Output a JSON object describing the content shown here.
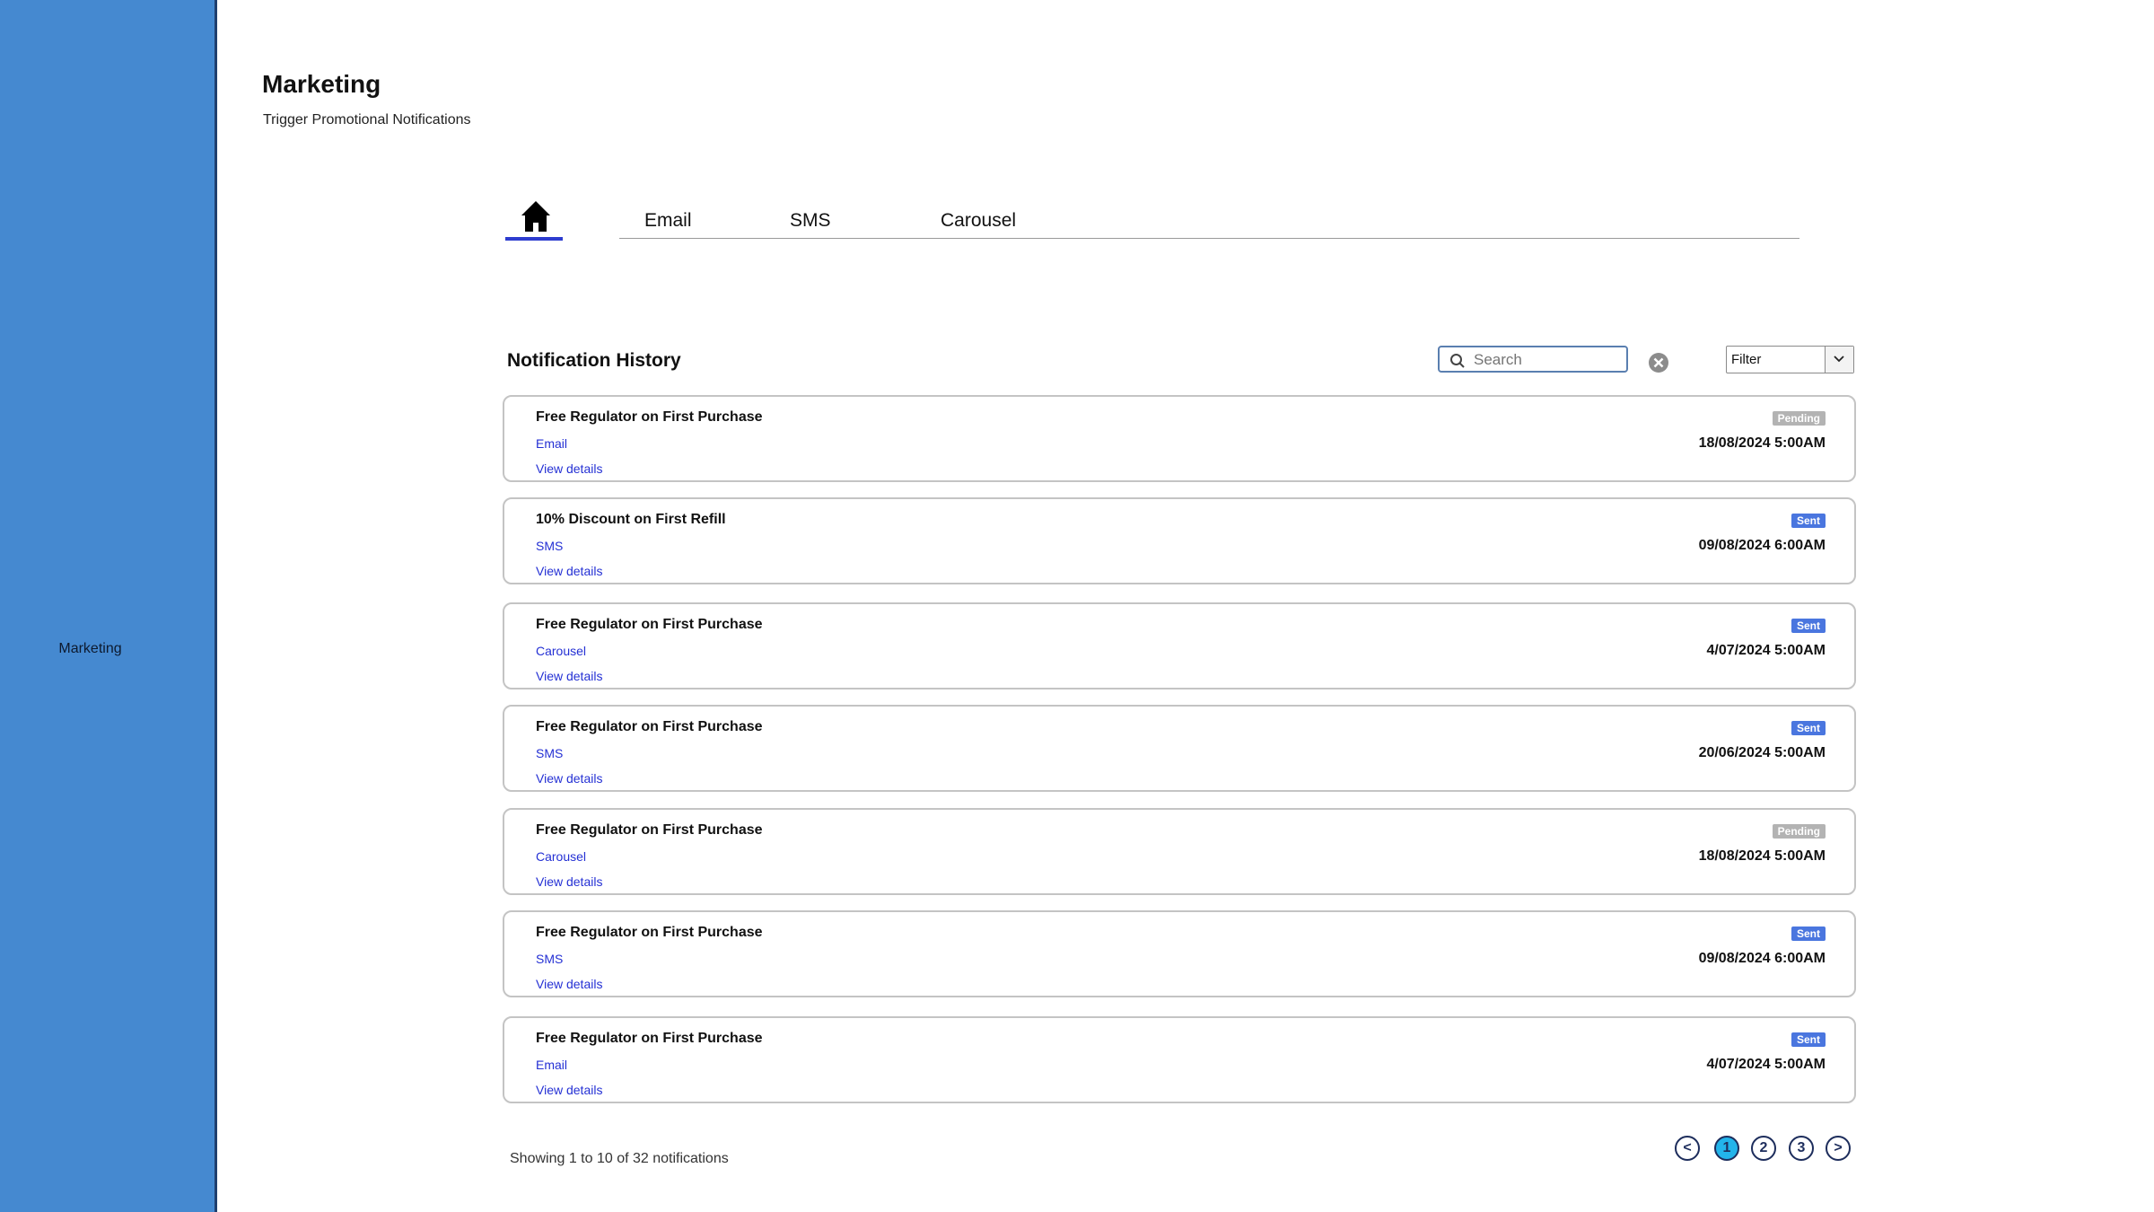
{
  "sidebar": {
    "items": [
      {
        "label": "Marketing"
      }
    ]
  },
  "header": {
    "title": "Marketing",
    "subtitle": "Trigger Promotional Notifications"
  },
  "tabs": [
    {
      "label": "home",
      "icon": "home-icon",
      "active": true
    },
    {
      "label": "Email"
    },
    {
      "label": "SMS"
    },
    {
      "label": "Carousel"
    }
  ],
  "section": {
    "title": "Notification History"
  },
  "search": {
    "placeholder": "Search",
    "value": ""
  },
  "filter": {
    "label": "Filter"
  },
  "colors": {
    "sidebar": "#4589d0",
    "accent": "#2d3ccf",
    "sent": "#4a76df",
    "pending": "#b3b3b3",
    "link": "#2430d4",
    "active_page": "#23b4ea"
  },
  "notifications": [
    {
      "title": "Free Regulator on First Purchase",
      "channel": "Email",
      "view": "View details",
      "status": "Pending",
      "date": "18/08/2024 5:00AM"
    },
    {
      "title": "10% Discount on First Refill",
      "channel": "SMS",
      "view": "View details",
      "status": "Sent",
      "date": "09/08/2024 6:00AM"
    },
    {
      "title": "Free Regulator on First Purchase",
      "channel": "Carousel",
      "view": "View details",
      "status": "Sent",
      "date": "4/07/2024 5:00AM"
    },
    {
      "title": "Free Regulator on First Purchase",
      "channel": "SMS",
      "view": "View details",
      "status": "Sent",
      "date": "20/06/2024 5:00AM"
    },
    {
      "title": "Free Regulator on First Purchase",
      "channel": "Carousel",
      "view": "View details",
      "status": "Pending",
      "date": "18/08/2024 5:00AM"
    },
    {
      "title": "Free Regulator on First Purchase",
      "channel": "SMS",
      "view": "View details",
      "status": "Sent",
      "date": "09/08/2024 6:00AM"
    },
    {
      "title": "Free Regulator on First Purchase",
      "channel": "Email",
      "view": "View details",
      "status": "Sent",
      "date": "4/07/2024 5:00AM"
    }
  ],
  "pagination": {
    "summary": "Showing 1 to 10 of 32 notifications",
    "prev": "<",
    "next": ">",
    "pages": [
      "1",
      "2",
      "3"
    ],
    "current": "1"
  }
}
